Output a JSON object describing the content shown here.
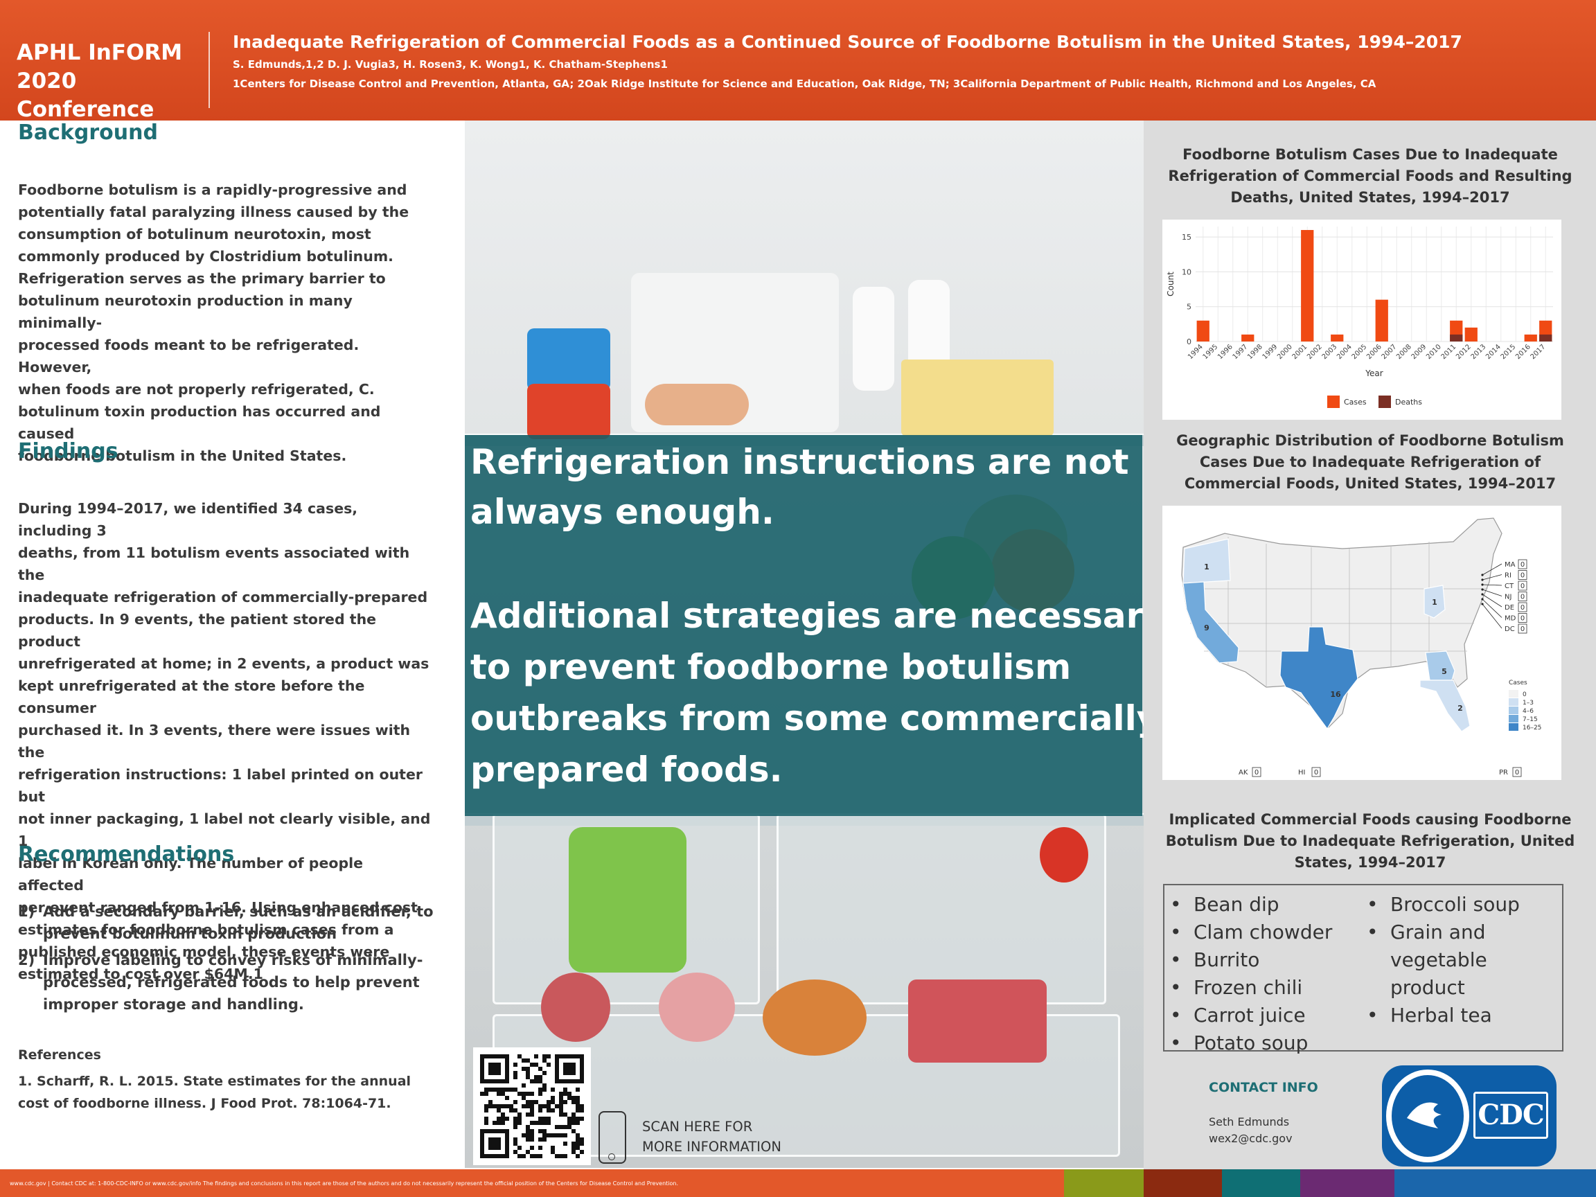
{
  "header": {
    "conference_line1": "APHL InFORM",
    "conference_line2": "2020 Conference",
    "title": "Inadequate Refrigeration of Commercial Foods as a Continued Source of Foodborne Botulism in the United States, 1994–2017",
    "authors": "S. Edmunds,1,2 D. J. Vugia3, H. Rosen3, K. Wong1, K. Chatham-Stephens1",
    "affiliations": "1Centers for Disease Control and Prevention, Atlanta, GA; 2Oak Ridge Institute for Science and Education, Oak Ridge, TN; 3California Department of Public Health, Richmond and Los Angeles, CA"
  },
  "background": {
    "heading": "Background",
    "lines": [
      "Foodborne botulism is a rapidly-progressive and",
      "potentially fatal paralyzing illness caused by the",
      "consumption of botulinum neurotoxin, most",
      "commonly produced by Clostridium botulinum.",
      "Refrigeration serves as the primary barrier to",
      "botulinum neurotoxin production in many minimally-",
      "processed foods meant to be refrigerated. However,",
      "when foods are not properly refrigerated, C.",
      "botulinum toxin production has occurred and caused",
      "foodborne botulism in the United States."
    ]
  },
  "findings": {
    "heading": "Findings",
    "lines": [
      "During 1994–2017, we identified 34 cases, including 3",
      "deaths, from 11 botulism events associated with the",
      "inadequate refrigeration of commercially-prepared",
      "products. In 9 events, the patient stored the product",
      "unrefrigerated at home; in 2 events, a product was",
      "kept unrefrigerated at the store before the consumer",
      "purchased it. In 3 events, there were issues with the",
      "refrigeration instructions: 1 label printed on outer but",
      "not inner packaging, 1 label not clearly visible, and 1",
      "label in Korean only. The number of people affected",
      "per event ranged from 1–16. Using enhanced cost",
      "estimates for foodborne botulism cases from a",
      "published economic model, these events were",
      "estimated to cost over $64M.1"
    ]
  },
  "recommendations": {
    "heading": "Recommendations",
    "items": [
      {
        "num": "1)",
        "text": "Add a secondary barrier, such as an acidifier, to prevent botulinum toxin production"
      },
      {
        "num": "2)",
        "text": "Improve labeling to convey risks of minimally-processed, refrigerated foods to help prevent improper storage and handling."
      }
    ]
  },
  "references": {
    "heading": "References",
    "text": "1. Scharff, R. L. 2015. State estimates for the annual cost of foodborne illness. J Food Prot. 78:1064-71."
  },
  "overlay": {
    "lines": [
      "Refrigeration instructions are not",
      "always enough.",
      "Additional strategies are necessary",
      "to prevent foodborne botulism",
      "outbreaks from some commercially-",
      "prepared foods."
    ]
  },
  "scan": {
    "line1": "SCAN HERE FOR",
    "line2": "MORE INFORMATION"
  },
  "chart_title": "Foodborne Botulism Cases Due to Inadequate Refrigeration of Commercial Foods and Resulting Deaths, United States, 1994–2017",
  "chart_data": {
    "type": "bar",
    "categories": [
      "1994",
      "1995",
      "1996",
      "1997",
      "1998",
      "1999",
      "2000",
      "2001",
      "2002",
      "2003",
      "2004",
      "2005",
      "2006",
      "2007",
      "2008",
      "2009",
      "2010",
      "2011",
      "2012",
      "2013",
      "2014",
      "2015",
      "2016",
      "2017"
    ],
    "series": [
      {
        "name": "Cases",
        "values": [
          3,
          0,
          0,
          1,
          0,
          0,
          0,
          16,
          0,
          1,
          0,
          0,
          6,
          0,
          0,
          0,
          0,
          3,
          2,
          0,
          0,
          0,
          1,
          3
        ],
        "color": "#f04a13"
      },
      {
        "name": "Deaths",
        "values": [
          0,
          0,
          0,
          0,
          0,
          0,
          0,
          0,
          0,
          0,
          0,
          0,
          0,
          0,
          0,
          0,
          0,
          1,
          0,
          0,
          0,
          0,
          0,
          1
        ],
        "color": "#7b2f24"
      }
    ],
    "xlabel": "Year",
    "ylabel": "Count",
    "yticks": [
      0,
      5,
      10,
      15
    ],
    "ylim": [
      0,
      16.5
    ],
    "grid": true,
    "legend_position": "bottom"
  },
  "map": {
    "title": "Geographic Distribution of Foodborne Botulism Cases Due to Inadequate Refrigeration of Commercial Foods, United States, 1994–2017",
    "state_values": [
      {
        "state": "OR",
        "value": "1"
      },
      {
        "state": "CA",
        "value": "9"
      },
      {
        "state": "TX",
        "value": "16"
      },
      {
        "state": "OH",
        "value": "1"
      },
      {
        "state": "GA",
        "value": "5"
      },
      {
        "state": "FL",
        "value": "2"
      }
    ],
    "small_states": [
      {
        "label": "MA",
        "value": "0"
      },
      {
        "label": "RI",
        "value": "0"
      },
      {
        "label": "CT",
        "value": "0"
      },
      {
        "label": "NJ",
        "value": "0"
      },
      {
        "label": "DE",
        "value": "0"
      },
      {
        "label": "MD",
        "value": "0"
      },
      {
        "label": "DC",
        "value": "0"
      }
    ],
    "territories": [
      {
        "label": "AK",
        "value": "0"
      },
      {
        "label": "HI",
        "value": "0"
      },
      {
        "label": "PR",
        "value": "0"
      }
    ],
    "legend_title": "Cases",
    "legend": [
      {
        "label": "0",
        "color": "#f2f2f2"
      },
      {
        "label": "1–3",
        "color": "#cfe0f2"
      },
      {
        "label": "4–6",
        "color": "#a9cbea"
      },
      {
        "label": "7–15",
        "color": "#72aadb"
      },
      {
        "label": "16–25",
        "color": "#3f86c8"
      }
    ]
  },
  "foods": {
    "title": "Implicated Commercial Foods causing Foodborne Botulism Due to Inadequate Refrigeration, United States, 1994–2017",
    "col1": [
      "Bean dip",
      "Clam chowder",
      "Burrito",
      "Frozen chili",
      "Carrot juice",
      "Potato soup"
    ],
    "col2": [
      "Broccoli soup",
      "Grain and vegetable product",
      "Herbal tea"
    ]
  },
  "contact": {
    "heading": "CONTACT INFO",
    "name": "Seth Edmunds",
    "email": "wex2@cdc.gov"
  },
  "logo_text": "CDC",
  "footer": {
    "text": "www.cdc.gov  |  Contact CDC at: 1-800-CDC-INFO or www.cdc.gov/info   The findings and conclusions in this report are those of the authors and do not necessarily represent the official position of the Centers for Disease Control and Prevention.",
    "bar_colors": [
      "#8a9a1a",
      "#8b2a10",
      "#0f6f74",
      "#6b2a72",
      "#1b66ab"
    ]
  }
}
